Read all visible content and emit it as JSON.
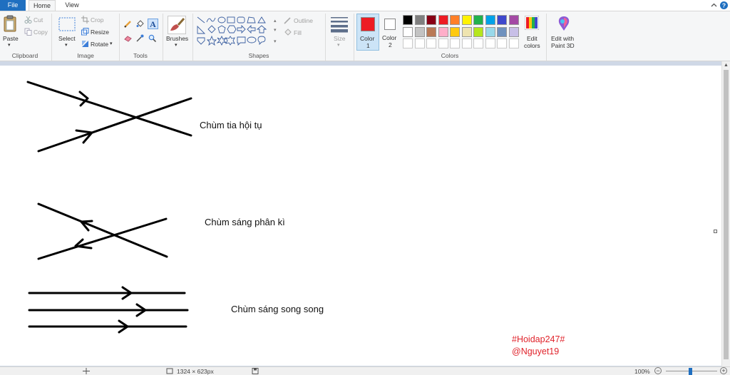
{
  "tabs": {
    "file": "File",
    "home": "Home",
    "view": "View"
  },
  "ribbon": {
    "clipboard": {
      "paste": "Paste",
      "cut": "Cut",
      "copy": "Copy",
      "label": "Clipboard"
    },
    "image": {
      "select": "Select",
      "crop": "Crop",
      "resize": "Resize",
      "rotate": "Rotate",
      "label": "Image"
    },
    "tools": {
      "label": "Tools"
    },
    "brushes": {
      "label": "Brushes"
    },
    "shapes": {
      "outline": "Outline",
      "fill": "Fill",
      "label": "Shapes"
    },
    "size": {
      "label": "Size"
    },
    "color1": {
      "line1": "Color",
      "line2": "1",
      "value": "#ed1c24"
    },
    "color2": {
      "line1": "Color",
      "line2": "2",
      "value": "#ffffff"
    },
    "colors": {
      "label": "Colors",
      "row1": [
        "#000000",
        "#7f7f7f",
        "#880015",
        "#ed1c24",
        "#ff7f27",
        "#fff200",
        "#22b14c",
        "#00a2e8",
        "#3f48cc",
        "#a349a4"
      ],
      "row2": [
        "#ffffff",
        "#c3c3c3",
        "#b97a57",
        "#ffaec9",
        "#ffc90e",
        "#efe4b0",
        "#b5e61d",
        "#99d9ea",
        "#7092be",
        "#c8bfe7"
      ]
    },
    "edit_colors": {
      "line1": "Edit",
      "line2": "colors"
    },
    "paint3d": {
      "line1": "Edit with",
      "line2": "Paint 3D"
    }
  },
  "canvas": {
    "caption1": "Chùm tia hội tụ",
    "caption2": "Chùm sáng phân kì",
    "caption3": "Chùm sáng song song",
    "watermark1": "#Hoidap247#",
    "watermark2": "@Nguyet19"
  },
  "status": {
    "dimensions": "1324 × 623px",
    "zoom": "100%"
  },
  "icons": [
    "paste-icon",
    "cut-icon",
    "copy-icon",
    "select-icon",
    "crop-icon",
    "resize-icon",
    "rotate-icon",
    "pencil-icon",
    "fill-icon",
    "text-icon",
    "eraser-icon",
    "color-picker-icon",
    "magnifier-icon",
    "brush-icon",
    "size-icon",
    "edit-colors-icon",
    "paint3d-icon",
    "help-icon",
    "collapse-ribbon-icon"
  ]
}
